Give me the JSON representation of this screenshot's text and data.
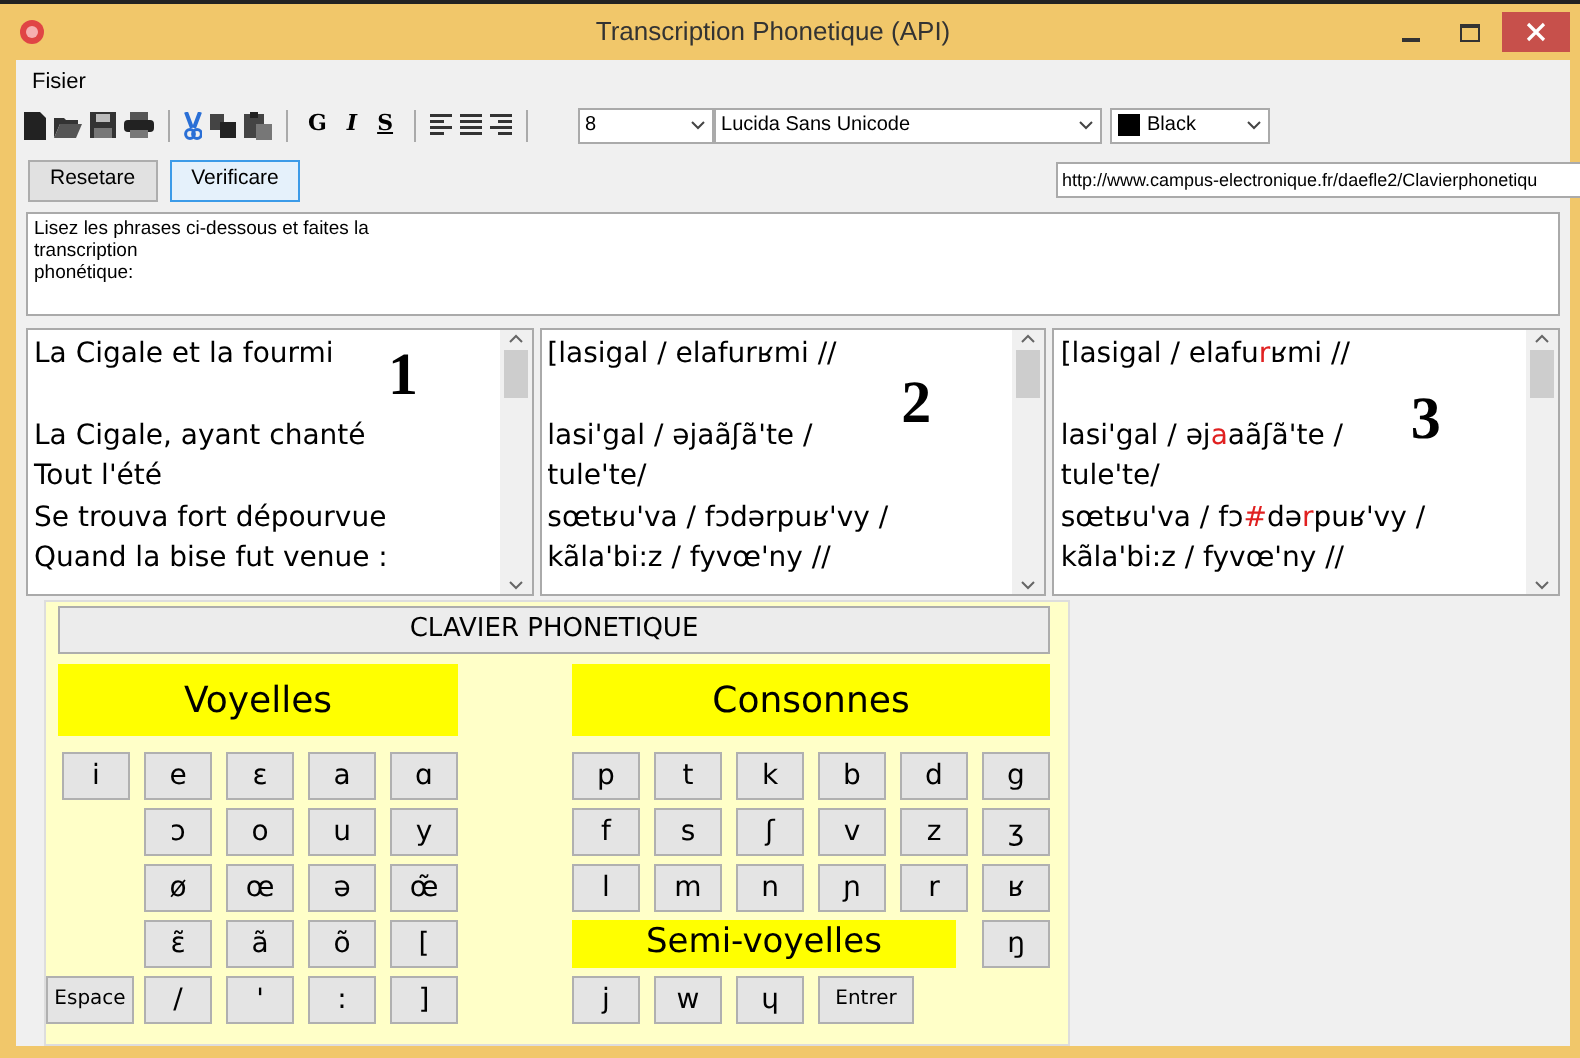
{
  "window": {
    "title": "Transcription Phonetique (API)"
  },
  "menu": [
    "Fisier"
  ],
  "toolbar": {
    "format_buttons": [
      {
        "label": "G",
        "kind": "bold"
      },
      {
        "label": "I",
        "kind": "italic"
      },
      {
        "label": "S",
        "kind": "underline"
      }
    ],
    "font_size": "8",
    "font_name": "Lucida Sans Unicode",
    "color": {
      "name": "Black",
      "color": "#000000"
    }
  },
  "buttons": [
    {
      "label": "Resetare",
      "focused": false
    },
    {
      "label": "Verificare",
      "focused": true
    }
  ],
  "url": "http://www.campus-electronique.fr/daefle2/Clavierphonetiqu",
  "instructions": [
    "Lisez les phrases ci-dessous et faites la",
    "transcription",
    "phonétique:"
  ],
  "panels": [
    {
      "marker": "1",
      "stanzas": [
        [
          [
            {
              "text": "La Cigale et la fourmi",
              "error": false
            }
          ]
        ],
        [
          [
            {
              "text": "La Cigale, ayant chanté",
              "error": false
            }
          ],
          [
            {
              "text": "Tout l'été",
              "error": false
            }
          ],
          [
            {
              "text": "Se trouva fort dépourvue",
              "error": false
            }
          ],
          [
            {
              "text": "Quand la bise fut venue :",
              "error": false
            }
          ]
        ]
      ]
    },
    {
      "marker": "2",
      "stanzas": [
        [
          [
            {
              "text": "[lasigal / elafurʁmi //",
              "error": false
            }
          ]
        ],
        [
          [
            {
              "text": "lasi'gal / əjaãʃã'te /",
              "error": false
            }
          ],
          [
            {
              "text": "tule'te/",
              "error": false
            }
          ],
          [
            {
              "text": "sœtʁu'va / fɔdərpuʁ'vy /",
              "error": false
            }
          ],
          [
            {
              "text": "kãla'bi:z / fyvœ'ny //",
              "error": false
            }
          ]
        ]
      ]
    },
    {
      "marker": "3",
      "stanzas": [
        [
          [
            {
              "text": "[lasigal / elafu",
              "error": false
            },
            {
              "text": "r",
              "error": true
            },
            {
              "text": "ʁmi //",
              "error": false
            }
          ]
        ],
        [
          [
            {
              "text": "lasi'gal / əj",
              "error": false
            },
            {
              "text": "a",
              "error": true
            },
            {
              "text": "aãʃã'te /",
              "error": false
            }
          ],
          [
            {
              "text": "tule'te/",
              "error": false
            }
          ],
          [
            {
              "text": "sœtʁu'va / fɔ",
              "error": false
            },
            {
              "text": "#",
              "error": true
            },
            {
              "text": "də",
              "error": false
            },
            {
              "text": "r",
              "error": true
            },
            {
              "text": "puʁ'vy /",
              "error": false
            }
          ],
          [
            {
              "text": "kãla'bi:z / fyvœ'ny //",
              "error": false
            }
          ]
        ]
      ]
    }
  ],
  "keyboard": {
    "title": "CLAVIER PHONETIQUE",
    "vowels": {
      "title": "Voyelles",
      "rows": [
        [
          "i",
          "e",
          "ɛ",
          "a",
          "ɑ"
        ],
        [
          "",
          "ɔ",
          "o",
          "u",
          "y"
        ],
        [
          "",
          "ø",
          "œ",
          "ə",
          "œ̃"
        ],
        [
          "",
          "ɛ̃",
          "ã",
          "õ",
          "["
        ],
        [
          "Espace",
          "/",
          "'",
          ":",
          "]"
        ]
      ]
    },
    "consonants": {
      "title": "Consonnes",
      "rows": [
        [
          "p",
          "t",
          "k",
          "b",
          "d",
          "g"
        ],
        [
          "f",
          "s",
          "ʃ",
          "v",
          "z",
          "ʒ"
        ],
        [
          "l",
          "m",
          "n",
          "ɲ",
          "r",
          "ʁ"
        ],
        [
          "",
          "",
          "",
          "",
          "",
          "ŋ"
        ]
      ]
    },
    "semi_vowels": {
      "title": "Semi-voyelles",
      "keys": [
        "j",
        "w",
        "ɥ"
      ]
    },
    "enter_key": "Entrer"
  }
}
